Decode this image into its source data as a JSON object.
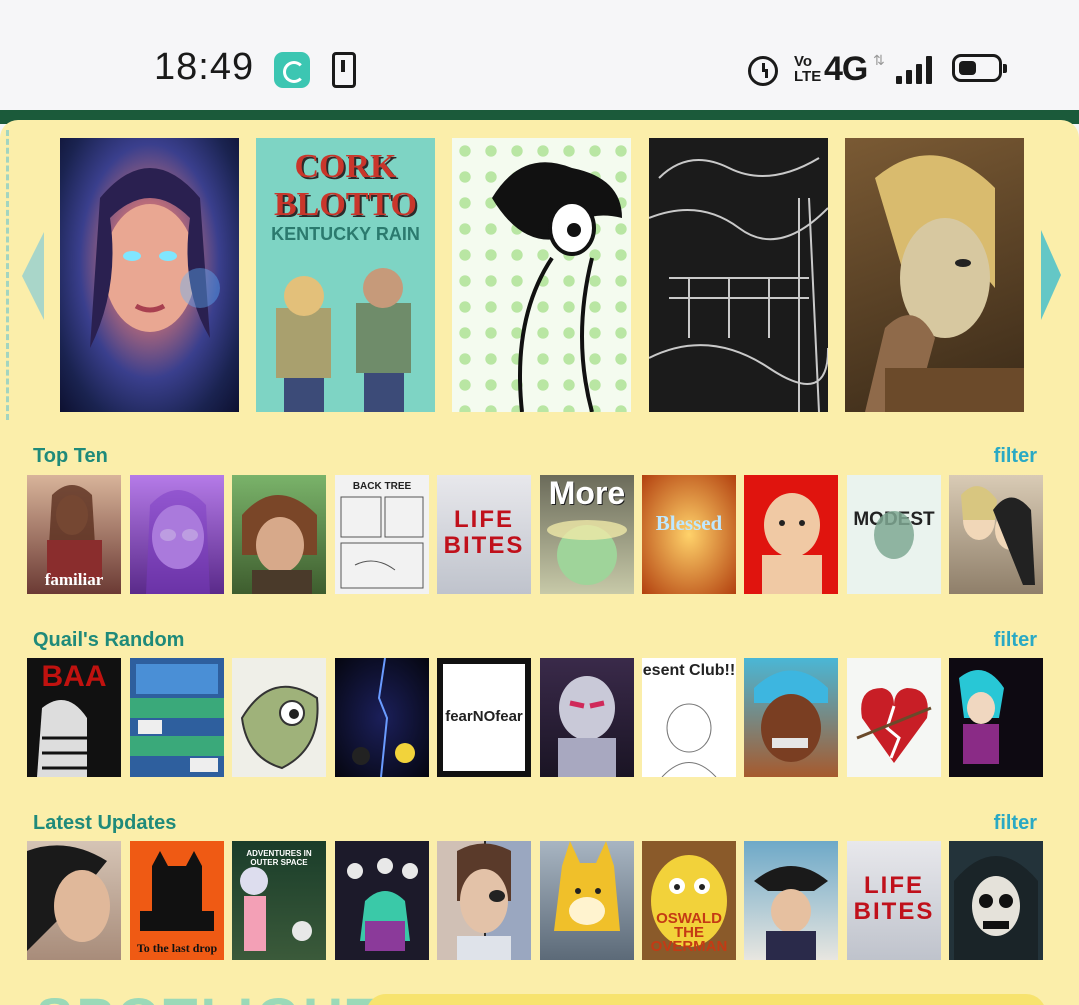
{
  "status_bar": {
    "time": "18:49",
    "volte": "Vo LTE",
    "network": "4G",
    "network_arrows": "⇅",
    "icons": [
      "app-notification-icon",
      "phone-notification-icon",
      "alarm-icon",
      "signal-icon",
      "battery-icon"
    ],
    "signal_level": 4,
    "battery_fraction": 0.5
  },
  "colors": {
    "header_green": "#1b5a3a",
    "page_background": "#fbeeaa",
    "section_title": "#1f8a7a",
    "filter_link": "#29a9c4",
    "arrow": "#64c7c6"
  },
  "featured": {
    "items": [
      {
        "name": "featured-comic-portrait",
        "caption": ""
      },
      {
        "name": "featured-comic-cork-blotto",
        "caption": "CORK BLOTTO",
        "subcaption": "KENTUCKY RAIN"
      },
      {
        "name": "featured-comic-cartoon-bird",
        "caption": ""
      },
      {
        "name": "featured-comic-forest",
        "caption": ""
      },
      {
        "name": "featured-comic-blonde-figure",
        "caption": ""
      }
    ]
  },
  "sections": [
    {
      "title": "Top Ten",
      "filter": "filter",
      "thumbs": [
        {
          "caption": "familiar"
        },
        {
          "caption": ""
        },
        {
          "caption": ""
        },
        {
          "caption": "BACK TREE"
        },
        {
          "caption": "LIFE BITES"
        },
        {
          "caption": "More"
        },
        {
          "caption": "Blessed Days"
        },
        {
          "caption": ""
        },
        {
          "caption": "MODEST MEDUSA"
        },
        {
          "caption": ""
        }
      ]
    },
    {
      "title": "Quail's Random",
      "filter": "filter",
      "thumbs": [
        {
          "caption": "BAA"
        },
        {
          "caption": ""
        },
        {
          "caption": ""
        },
        {
          "caption": ""
        },
        {
          "caption": "fearNOfear"
        },
        {
          "caption": ""
        },
        {
          "caption": "esent Club!!"
        },
        {
          "caption": ""
        },
        {
          "caption": ""
        },
        {
          "caption": ""
        }
      ]
    },
    {
      "title": "Latest Updates",
      "filter": "filter",
      "thumbs": [
        {
          "caption": ""
        },
        {
          "caption": "To the last drop"
        },
        {
          "caption": "ADVENTURES IN OUTER SPACE"
        },
        {
          "caption": ""
        },
        {
          "caption": ""
        },
        {
          "caption": ""
        },
        {
          "caption": "OSWALD THE OVERMAN"
        },
        {
          "caption": ""
        },
        {
          "caption": "LIFE BITES"
        },
        {
          "caption": ""
        }
      ]
    }
  ],
  "spotlight": {
    "title": "SPOTLIGHT"
  }
}
